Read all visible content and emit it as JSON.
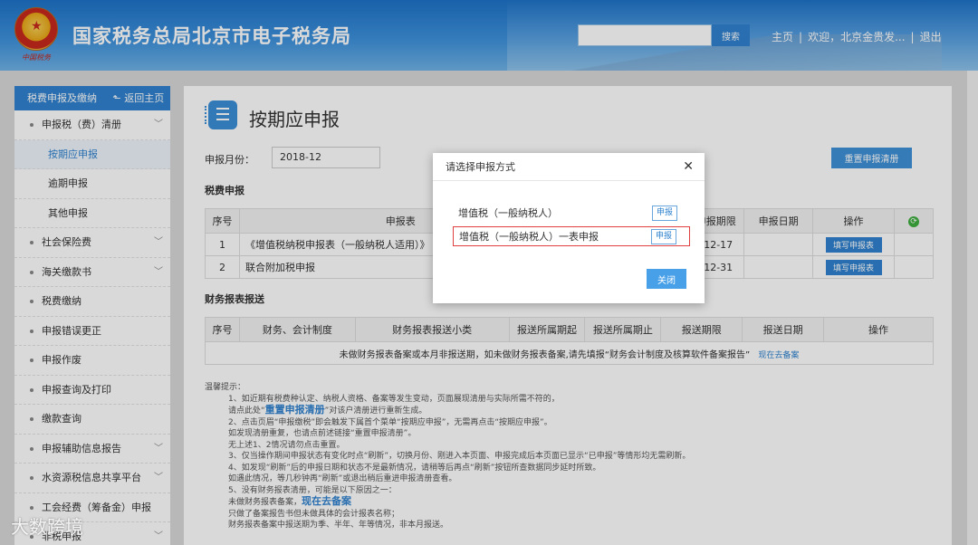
{
  "header": {
    "brand_sub": "中国税务",
    "title": "国家税务总局北京市电子税务局",
    "search_placeholder": "",
    "search_btn": "搜索",
    "home": "主页",
    "welcome": "欢迎，北京金贵发...",
    "logout": "退出"
  },
  "sidebar": {
    "head": "税费申报及缴纳",
    "back": "返回主页",
    "items": [
      {
        "label": "申报税（费）清册",
        "chev": "﹀"
      },
      {
        "label": "按期应申报"
      },
      {
        "label": "逾期申报"
      },
      {
        "label": "其他申报"
      },
      {
        "label": "社会保险费",
        "chev": "﹀"
      },
      {
        "label": "海关缴款书",
        "chev": "﹀"
      },
      {
        "label": "税费缴纳"
      },
      {
        "label": "申报错误更正"
      },
      {
        "label": "申报作废"
      },
      {
        "label": "申报查询及打印"
      },
      {
        "label": "缴款查询"
      },
      {
        "label": "申报辅助信息报告",
        "chev": "﹀"
      },
      {
        "label": "水资源税信息共享平台",
        "chev": "﹀"
      },
      {
        "label": "工会经费（筹备金）申报"
      },
      {
        "label": "非税申报",
        "chev": "﹀"
      }
    ]
  },
  "main": {
    "title": "按期应申报",
    "period_label": "申报月份：",
    "period_value": "2018-12",
    "reset_btn": "重置申报清册",
    "tax_section": "税费申报",
    "tax_headers": [
      "序号",
      "申报表",
      "申报期限",
      "申报日期",
      "操作"
    ],
    "tax_rows": [
      {
        "no": "1",
        "name": "《增值税纳税申报表（一般纳税人适用）》",
        "deadline": "8-12-17",
        "date": "",
        "op": "填写申报表"
      },
      {
        "no": "2",
        "name": "联合附加税申报",
        "deadline": "8-12-31",
        "date": "",
        "op": "填写申报表"
      }
    ],
    "fin_section": "财务报表报送",
    "fin_headers": [
      "序号",
      "财务、会计制度",
      "财务报表报送小类",
      "报送所属期起",
      "报送所属期止",
      "报送期限",
      "报送日期",
      "操作"
    ],
    "fin_empty": "未做财务报表备案或本月非报送期，如未做财务报表备案,请先填报“财务会计制度及核算软件备案报告”",
    "fin_link": "现在去备案",
    "tips": {
      "title": "温馨提示：",
      "l1": "1、如近期有税费种认定、纳税人资格、备案等发生变动，页面展现清册与实际所需不符的，",
      "l2a": "请点此处“",
      "l2link": "重置申报清册",
      "l2b": "”对该户清册进行重新生成。",
      "l3": "2、点击页眉“申报缴税”即会触发下属首个菜单“按期应申报”，无需再点击“按期应申报”。",
      "l4": "如发现清册重复，也请点前述链接“重置申报清册”。",
      "l5": "无上述1、2情况请勿点击重置。",
      "l6": "3、仅当操作期间申报状态有变化时点“刷新”，切换月份、刚进入本页面、申报完成后本页面已显示“已申报”等情形均无需刷新。",
      "l7": "4、如发现“刷新”后的申报日期和状态不是最新情况，请稍等后再点“刷新”按钮所查数据同步延时所致。",
      "l8": "如遇此情况，等几秒钟再“刷新”或退出稍后重进申报清册查看。",
      "l9": "5、没有财务报表清册，可能是以下原因之一：",
      "l10a": "未做财务报表备案，",
      "l10link": "现在去备案",
      "l11": "只做了备案报告书但未做具体的会计报表名称；",
      "l12": "财务报表备案中报送期为季、半年、年等情况，非本月报送。"
    }
  },
  "modal": {
    "title": "请选择申报方式",
    "close": "✕",
    "row1": "增值税（一般纳税人）",
    "row2": "增值税（一般纳税人）一表申报",
    "btn": "申报",
    "ok": "关闭"
  },
  "watermark": "大数跨境"
}
